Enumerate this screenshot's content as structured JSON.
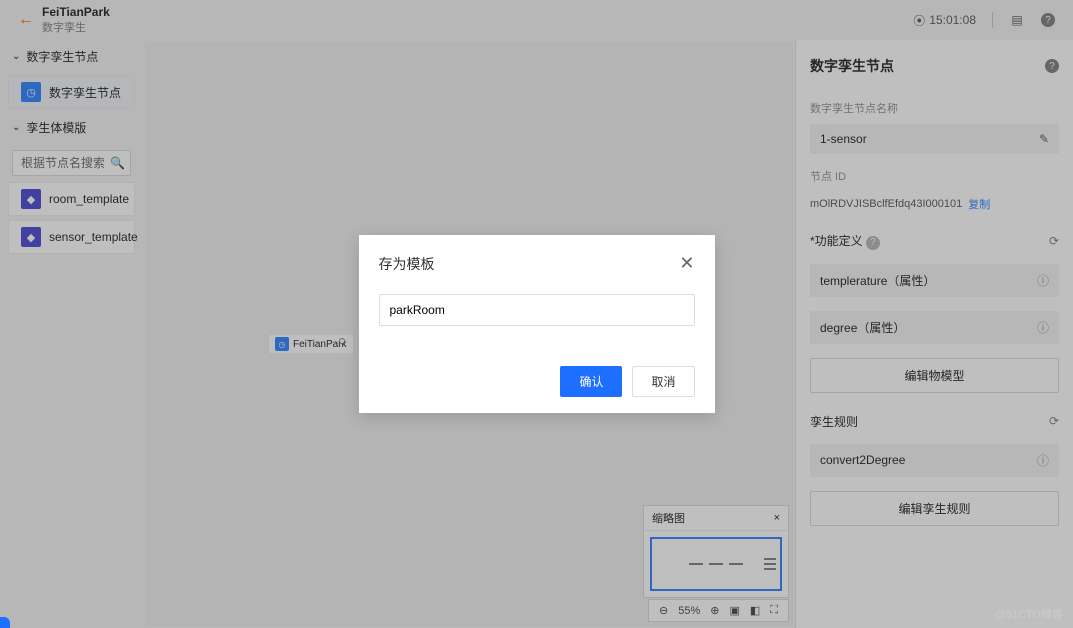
{
  "header": {
    "title": "FeiTianPark",
    "subtitle": "数字孪生",
    "time": "15:01:08"
  },
  "sidebar": {
    "section1": {
      "title": "数字孪生节点",
      "items": [
        {
          "label": "数字孪生节点"
        }
      ]
    },
    "section2": {
      "title": "孪生体模版",
      "search_placeholder": "根据节点名搜索",
      "items": [
        {
          "label": "room_template"
        },
        {
          "label": "sensor_template"
        }
      ]
    }
  },
  "canvas": {
    "node_label": "FeiTianPark",
    "thumbnail_title": "缩略图",
    "zoom": "55%"
  },
  "right": {
    "title": "数字孪生节点",
    "name_label": "数字孪生节点名称",
    "name_value": "1-sensor",
    "id_label": "节点 ID",
    "id_value": "mOlRDVJISBclfEfdq43I000101",
    "copy": "复制",
    "funcdef_label": "*功能定义",
    "props": [
      {
        "label": "templerature（属性）"
      },
      {
        "label": "degree（属性）"
      }
    ],
    "edit_model_btn": "编辑物模型",
    "rules_label": "孪生规则",
    "rules": [
      {
        "label": "convert2Degree"
      }
    ],
    "edit_rules_btn": "编辑孪生规则"
  },
  "modal": {
    "title": "存为模板",
    "value": "parkRoom",
    "confirm": "确认",
    "cancel": "取消"
  },
  "watermark": "@51CTO博客"
}
